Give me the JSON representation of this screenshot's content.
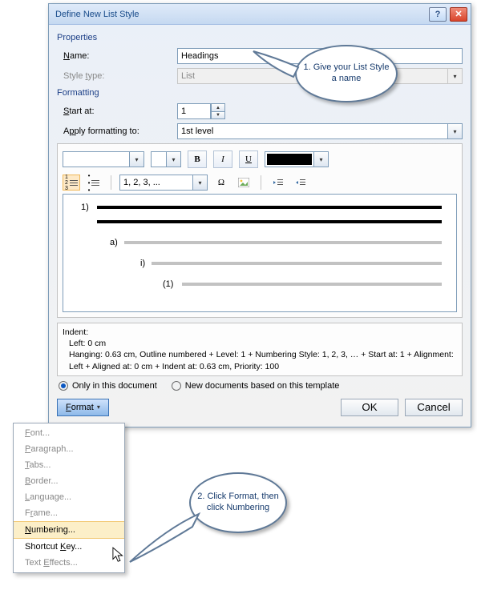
{
  "window": {
    "title": "Define New List Style"
  },
  "sections": {
    "properties": "Properties",
    "formatting": "Formatting"
  },
  "labels": {
    "name": "Name:",
    "styletype": "Style type:",
    "startat": "Start at:",
    "applyto": "Apply formatting to:"
  },
  "fields": {
    "name_value": "Headings",
    "styletype_value": "List",
    "startat_value": "1",
    "applyto_value": "1st level",
    "number_style_value": "1, 2, 3, ..."
  },
  "preview": {
    "l1": "1)",
    "l2": "a)",
    "l3": "i)",
    "l4": "(1)"
  },
  "desc": {
    "title": "Indent:",
    "line1": "Left:  0 cm",
    "line2": "Hanging:  0.63 cm, Outline numbered + Level: 1 + Numbering Style: 1, 2, 3, … + Start at: 1 + Alignment: Left + Aligned at:  0 cm + Indent at:  0.63 cm, Priority: 100"
  },
  "radios": {
    "only": "Only in this document",
    "newdocs": "New documents based on this template"
  },
  "buttons": {
    "format": "Format",
    "ok": "OK",
    "cancel": "Cancel"
  },
  "menu": {
    "font": "Font...",
    "paragraph": "Paragraph...",
    "tabs": "Tabs...",
    "border": "Border...",
    "language": "Language...",
    "frame": "Frame...",
    "numbering": "Numbering...",
    "shortcut": "Shortcut Key...",
    "effects": "Text Effects..."
  },
  "callouts": {
    "c1": "1. Give your List Style a name",
    "c2": "2. Click Format, then click Numbering"
  },
  "colors": {
    "accent": "#5f7997"
  }
}
